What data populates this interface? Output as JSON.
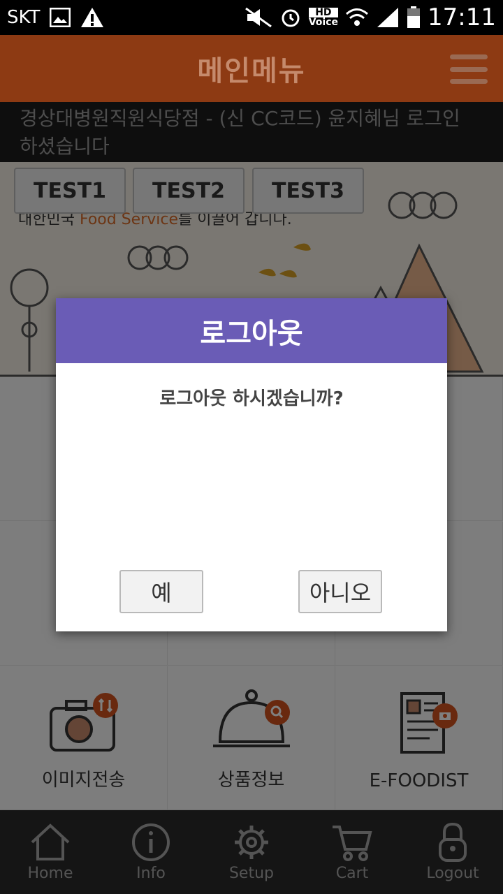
{
  "status_bar": {
    "carrier": "SKT",
    "time": "17:11",
    "hd_top": "HD",
    "hd_bottom": "Voice"
  },
  "header": {
    "title": "메인메뉴"
  },
  "login_info": {
    "text": "경상대병원직원식당점 - (신 CC코드) 윤지혜님 로그인 하셨습니다"
  },
  "banner": {
    "tagline_prefix": "대한민국 ",
    "tagline_accent": "Food Service",
    "tagline_suffix": "를 이끌어 갑니다.",
    "test_buttons": [
      "TEST1",
      "TEST2",
      "TEST3"
    ]
  },
  "grid": {
    "items": [
      {
        "label": "이미지전송",
        "icon": "camera-icon"
      },
      {
        "label": "상품정보",
        "icon": "cloche-icon"
      },
      {
        "label": "E-FOODIST",
        "icon": "document-icon"
      }
    ]
  },
  "bottom_nav": {
    "items": [
      {
        "label": "Home",
        "icon": "home-icon"
      },
      {
        "label": "Info",
        "icon": "info-icon"
      },
      {
        "label": "Setup",
        "icon": "gear-icon"
      },
      {
        "label": "Cart",
        "icon": "cart-icon"
      },
      {
        "label": "Logout",
        "icon": "lock-icon"
      }
    ]
  },
  "dialog": {
    "title": "로그아웃",
    "message": "로그아웃 하시겠습니까?",
    "yes_label": "예",
    "no_label": "아니오"
  },
  "colors": {
    "appbar": "#8d3a13",
    "dialog_header": "#6a5cb6",
    "accent_orange": "#d86b28",
    "nav_background": "#2a2a2a"
  }
}
